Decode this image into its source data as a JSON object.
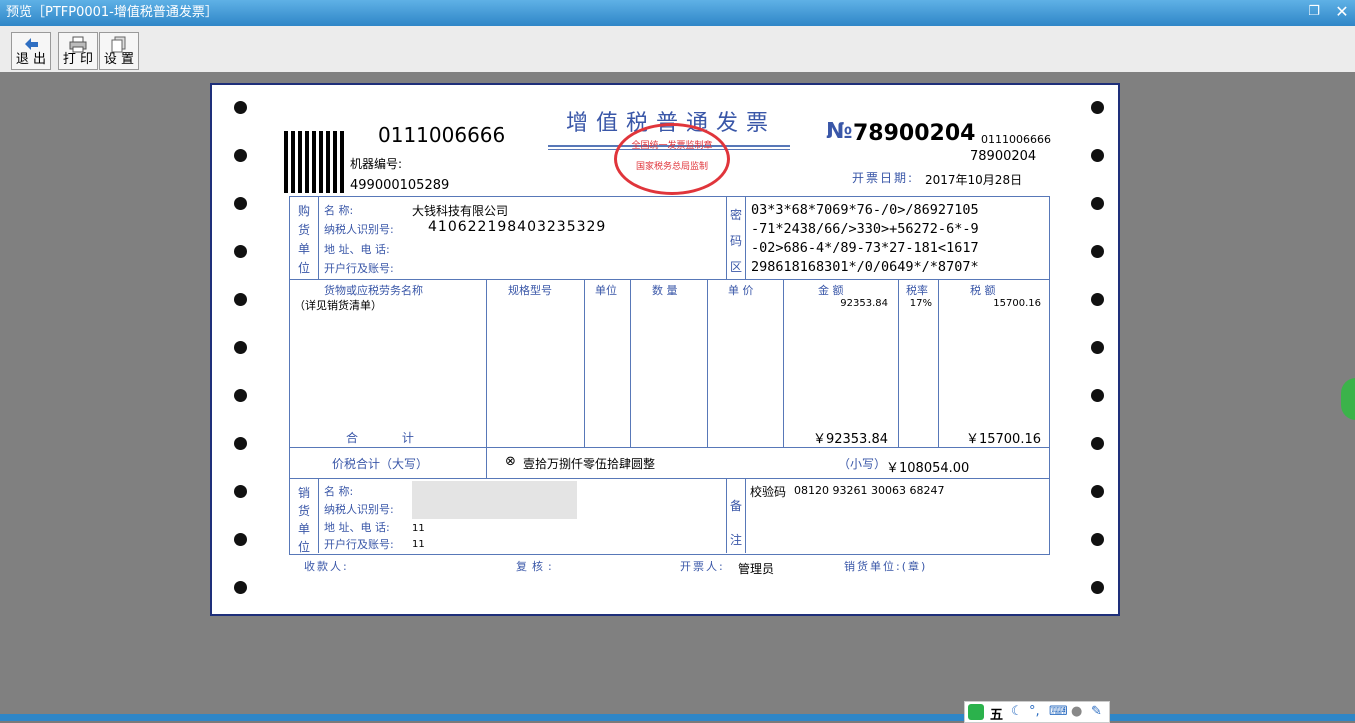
{
  "window": {
    "title": "预览［PTFP0001-增值税普通发票］",
    "restore_icon": "restore-icon",
    "close_icon": "close-icon"
  },
  "toolbar": {
    "exit_label": "退 出",
    "print_label": "打 印",
    "settings_label": "设 置"
  },
  "invoice": {
    "title": "增值税普通发票",
    "invoice_code_top": "0111006666",
    "machine_label": "机器编号:",
    "machine_no": "499000105289",
    "no_symbol": "№",
    "invoice_no": "78900204",
    "code_right": "0111006666",
    "no_right": "78900204",
    "date_label": "开票日期:",
    "date": "2017年10月28日",
    "stamp_top": "全国统一发票监制章",
    "stamp_bottom": "国家税务总局监制",
    "buyer": {
      "side": [
        "购",
        "货",
        "单",
        "位"
      ],
      "name_label": "名 称:",
      "name": "大钱科技有限公司",
      "tax_label": "纳税人识别号:",
      "tax_id": "410622198403235329",
      "addr_label": "地 址、电 话:",
      "bank_label": "开户行及账号:"
    },
    "cipher": {
      "side": [
        "密",
        "码",
        "区"
      ],
      "lines": [
        "03*3*68*7069*76-/0>/86927105",
        "-71*2438/66/>330>+56272-6*-9",
        "-02>686-4*/89-73*27-181<1617",
        "298618168301*/0/0649*/*8707*"
      ]
    },
    "columns": {
      "goods": "货物或应税劳务名称",
      "spec": "规格型号",
      "unit": "单位",
      "qty": "数 量",
      "price": "单 价",
      "amount": "金 额",
      "rate": "税率",
      "tax": "税 额"
    },
    "item": {
      "goods": "（详见销货清单）",
      "amount": "92353.84",
      "rate": "17%",
      "tax": "15700.16"
    },
    "total_label": "合 计",
    "total_amount": "￥92353.84",
    "total_tax": "￥15700.16",
    "grand_label": "价税合计（大写）",
    "grand_symbol": "⊗",
    "grand_words": "壹拾万捌仟零伍拾肆圆整",
    "small_label": "（小写）",
    "grand_number": "￥108054.00",
    "seller": {
      "side": [
        "销",
        "货",
        "单",
        "位"
      ],
      "name_label": "名 称:",
      "tax_label": "纳税人识别号:",
      "addr_label": "地 址、电 话:",
      "addr": "11",
      "bank_label": "开户行及账号:",
      "bank": "11"
    },
    "remark": {
      "side": [
        "备",
        "注"
      ],
      "check_label": "校验码",
      "check_code": "08120 93261 30063 68247"
    },
    "footer": {
      "payee": "收款人:",
      "review": "复核:",
      "drawer_label": "开票人:",
      "drawer": "管理员",
      "seller_seal": "销货单位:(章)"
    }
  },
  "ime": {
    "lang": "五",
    "icons": [
      "sogou-icon",
      "moon-icon",
      "punct-icon",
      "keyboard-icon",
      "user-icon",
      "wrench-icon"
    ]
  }
}
